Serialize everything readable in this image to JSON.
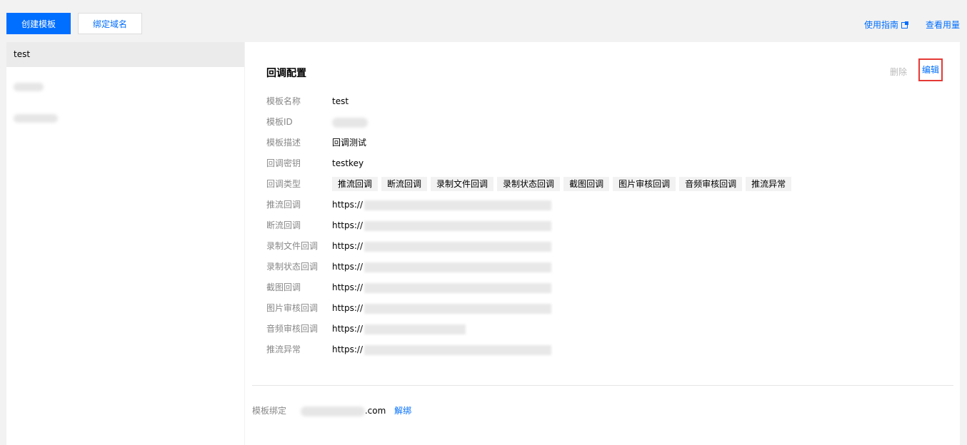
{
  "toolbar": {
    "create_label": "创建模板",
    "bind_label": "绑定域名",
    "guide_label": "使用指南",
    "usage_label": "查看用量",
    "guide_icon": "external-link-icon"
  },
  "sidebar": {
    "items": [
      {
        "label": "test",
        "active": true
      }
    ]
  },
  "detail": {
    "title": "回调配置",
    "delete_label": "删除",
    "edit_label": "编辑",
    "fields": {
      "name_label": "模板名称",
      "name_value": "test",
      "id_label": "模板ID",
      "desc_label": "模板描述",
      "desc_value": "回调测试",
      "key_label": "回调密钥",
      "key_value": "testkey",
      "type_label": "回调类型"
    },
    "types": [
      "推流回调",
      "断流回调",
      "录制文件回调",
      "录制状态回调",
      "截图回调",
      "图片审核回调",
      "音频审核回调",
      "推流异常"
    ],
    "urls": [
      {
        "label": "推流回调",
        "prefix": "https://"
      },
      {
        "label": "断流回调",
        "prefix": "https://"
      },
      {
        "label": "录制文件回调",
        "prefix": "https://"
      },
      {
        "label": "录制状态回调",
        "prefix": "https://"
      },
      {
        "label": "截图回调",
        "prefix": "https://"
      },
      {
        "label": "图片审核回调",
        "prefix": "https://"
      },
      {
        "label": "音频审核回调",
        "prefix": "https://"
      },
      {
        "label": "推流异常",
        "prefix": "https://"
      }
    ],
    "binding": {
      "label": "模板绑定",
      "domain_suffix": ".com",
      "unbind_label": "解绑"
    }
  },
  "colors": {
    "primary": "#006eff",
    "highlight_border": "#e53935",
    "label_gray": "#888888"
  }
}
